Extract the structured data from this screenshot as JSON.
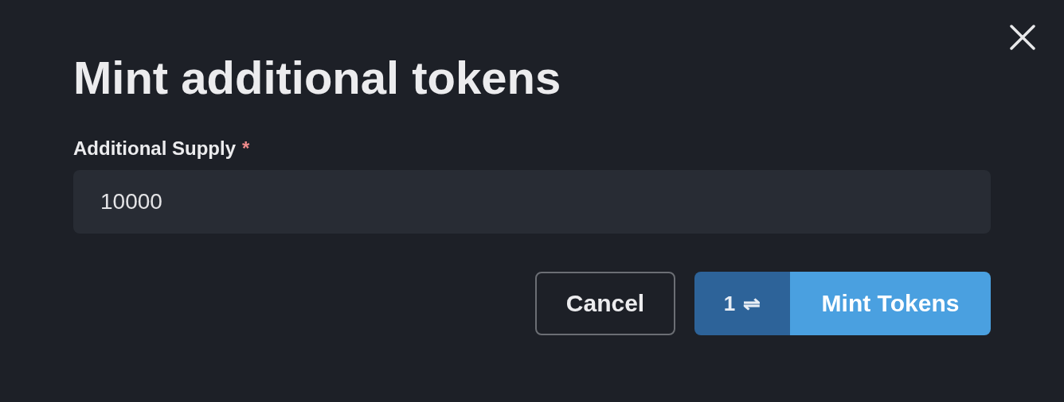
{
  "dialog": {
    "title": "Mint additional tokens",
    "field": {
      "label": "Additional Supply",
      "required_mark": "*",
      "value": "10000"
    },
    "cancel_button": {
      "label": "Cancel"
    },
    "submit_button": {
      "count": "1",
      "swap_symbol": "⇌",
      "label": "Mint Tokens"
    }
  }
}
